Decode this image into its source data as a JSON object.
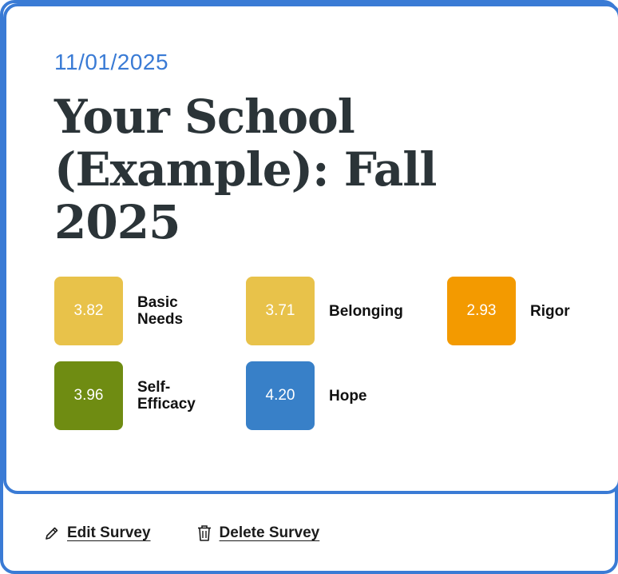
{
  "card": {
    "date": "11/01/2025",
    "title": "Your School (Example): Fall 2025",
    "metrics": [
      {
        "score": "3.82",
        "label": "Basic Needs",
        "color": "#e8c24a"
      },
      {
        "score": "3.71",
        "label": "Belonging",
        "color": "#e8c24a"
      },
      {
        "score": "2.93",
        "label": "Rigor",
        "color": "#f39a00"
      },
      {
        "score": "3.96",
        "label": "Self-Efficacy",
        "color": "#6f8c12"
      },
      {
        "score": "4.20",
        "label": "Hope",
        "color": "#3880c8"
      }
    ]
  },
  "actions": {
    "edit_label": "Edit Survey",
    "edit_icon": "pencil-icon",
    "delete_label": "Delete Survey",
    "delete_icon": "trash-icon"
  },
  "colors": {
    "accent": "#3a7bd5",
    "title_text": "#2b3438"
  }
}
